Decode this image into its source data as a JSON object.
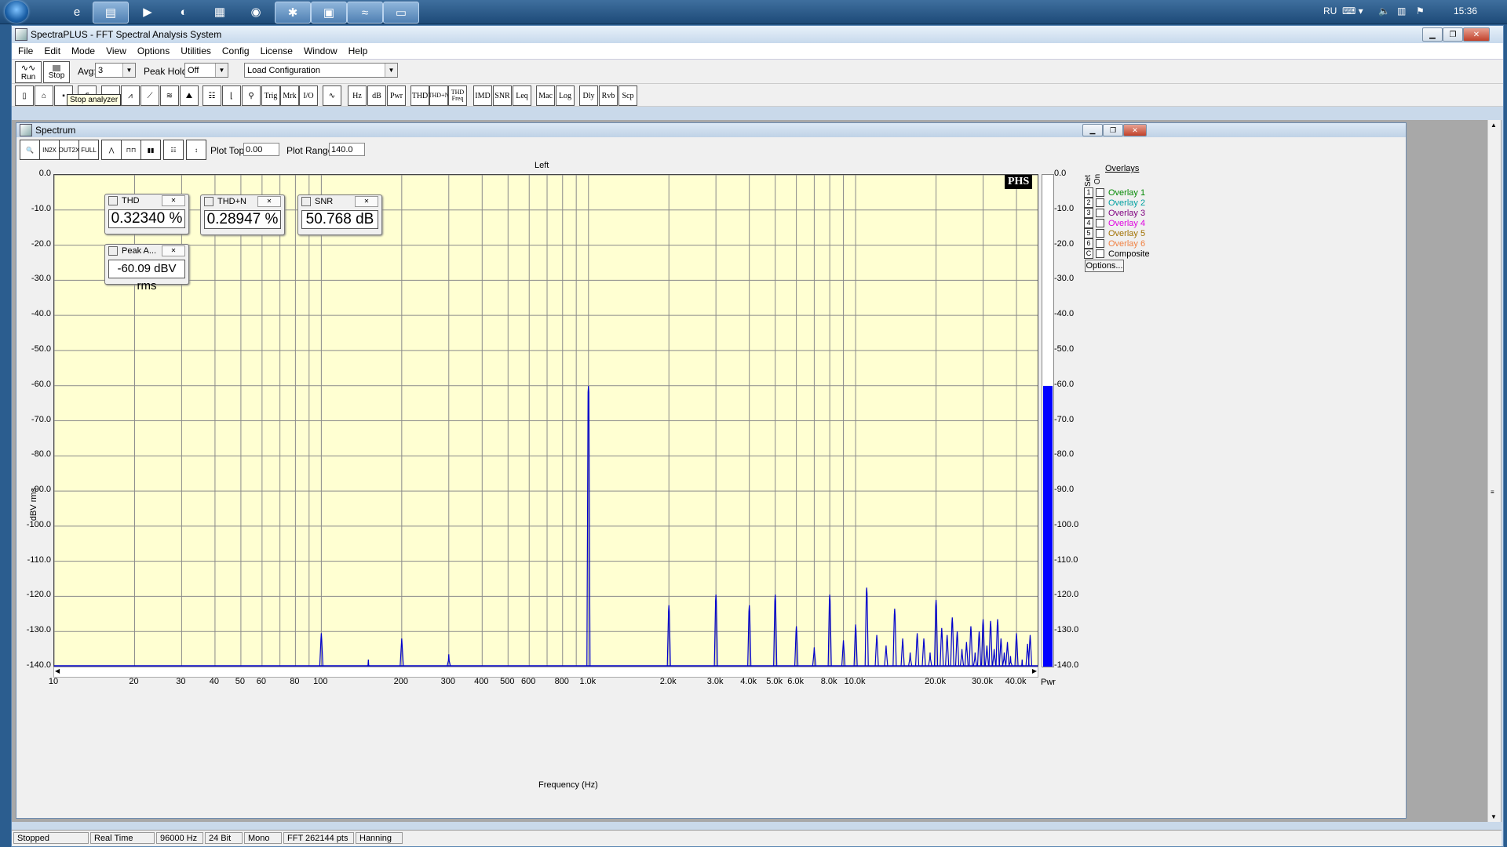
{
  "taskbar": {
    "lang": "RU",
    "clock": "15:36"
  },
  "app": {
    "title": "SpectraPLUS - FFT Spectral Analysis System"
  },
  "menu": [
    "File",
    "Edit",
    "Mode",
    "View",
    "Options",
    "Utilities",
    "Config",
    "License",
    "Window",
    "Help"
  ],
  "toolbar1": {
    "run": "Run",
    "stop": "Stop",
    "avg_label": "Avg:",
    "avg_value": "3",
    "peak_hold_label": "Peak Hold:",
    "peak_hold_value": "Off",
    "config_value": "Load Configuration",
    "tooltip": "Stop analyzer"
  },
  "toolbar2": [
    "Trig",
    "Mrk",
    "I/O",
    "Hz",
    "dB",
    "Pwr",
    "THD",
    "THD+N",
    "THD Freq",
    "IMD",
    "SNR",
    "Leq",
    "Mac",
    "Log",
    "Dly",
    "Rvb",
    "Scp"
  ],
  "spectrum": {
    "title": "Spectrum",
    "plot_top_label": "Plot Top:",
    "plot_top_value": "0.00",
    "plot_range_label": "Plot Range:",
    "plot_range_value": "140.0",
    "channel": "Left",
    "logo": "PHS",
    "meters": {
      "thd": {
        "title": "THD",
        "value": "0.32340 %"
      },
      "thdn": {
        "title": "THD+N",
        "value": "0.28947 %"
      },
      "snr": {
        "title": "SNR",
        "value": "50.768 dB"
      },
      "peak": {
        "title": "Peak A...",
        "value": "-60.09 dBV rms"
      }
    },
    "overlays": {
      "header": "Overlays",
      "set_label": "Set",
      "on_label": "On",
      "items": [
        {
          "num": "1",
          "name": "Overlay 1",
          "color": "#008800"
        },
        {
          "num": "2",
          "name": "Overlay 2",
          "color": "#00a0a0"
        },
        {
          "num": "3",
          "name": "Overlay 3",
          "color": "#800080"
        },
        {
          "num": "4",
          "name": "Overlay 4",
          "color": "#e000e0"
        },
        {
          "num": "5",
          "name": "Overlay 5",
          "color": "#a07000"
        },
        {
          "num": "6",
          "name": "Overlay 6",
          "color": "#f08040"
        },
        {
          "num": "C",
          "name": "Composite",
          "color": "#000000"
        }
      ],
      "options_button": "Options..."
    },
    "pwr_label": "Pwr"
  },
  "chart_data": {
    "type": "line",
    "title": "Left",
    "xlabel": "Frequency (Hz)",
    "ylabel": "dBV rms",
    "x_scale": "log",
    "xlim": [
      10,
      48000
    ],
    "ylim": [
      -140,
      0
    ],
    "y_ticks": [
      "0.0",
      "-10.0",
      "-20.0",
      "-30.0",
      "-40.0",
      "-50.0",
      "-60.0",
      "-70.0",
      "-80.0",
      "-90.0",
      "-100.0",
      "-110.0",
      "-120.0",
      "-130.0",
      "-140.0"
    ],
    "x_ticks": [
      {
        "v": 10,
        "t": "10"
      },
      {
        "v": 20,
        "t": "20"
      },
      {
        "v": 30,
        "t": "30"
      },
      {
        "v": 40,
        "t": "40"
      },
      {
        "v": 50,
        "t": "50"
      },
      {
        "v": 60,
        "t": "60"
      },
      {
        "v": 80,
        "t": "80"
      },
      {
        "v": 100,
        "t": "100"
      },
      {
        "v": 200,
        "t": "200"
      },
      {
        "v": 300,
        "t": "300"
      },
      {
        "v": 400,
        "t": "400"
      },
      {
        "v": 500,
        "t": "500"
      },
      {
        "v": 600,
        "t": "600"
      },
      {
        "v": 800,
        "t": "800"
      },
      {
        "v": 1000,
        "t": "1.0k"
      },
      {
        "v": 2000,
        "t": "2.0k"
      },
      {
        "v": 3000,
        "t": "3.0k"
      },
      {
        "v": 4000,
        "t": "4.0k"
      },
      {
        "v": 5000,
        "t": "5.0k"
      },
      {
        "v": 6000,
        "t": "6.0k"
      },
      {
        "v": 8000,
        "t": "8.0k"
      },
      {
        "v": 10000,
        "t": "10.0k"
      },
      {
        "v": 20000,
        "t": "20.0k"
      },
      {
        "v": 30000,
        "t": "30.0k"
      },
      {
        "v": 40000,
        "t": "40.0k"
      }
    ],
    "noise_floor": -140,
    "peaks": [
      {
        "f": 100,
        "db": -130.5
      },
      {
        "f": 150,
        "db": -138
      },
      {
        "f": 200,
        "db": -132
      },
      {
        "f": 300,
        "db": -136.5
      },
      {
        "f": 1000,
        "db": -60.1
      },
      {
        "f": 2000,
        "db": -122.5
      },
      {
        "f": 3000,
        "db": -119.5
      },
      {
        "f": 4000,
        "db": -122.5
      },
      {
        "f": 5000,
        "db": -119.5
      },
      {
        "f": 6000,
        "db": -128.5
      },
      {
        "f": 7000,
        "db": -134.5
      },
      {
        "f": 8000,
        "db": -119.5
      },
      {
        "f": 9000,
        "db": -132.5
      },
      {
        "f": 10000,
        "db": -128
      },
      {
        "f": 11000,
        "db": -117.5
      },
      {
        "f": 12000,
        "db": -131
      },
      {
        "f": 13000,
        "db": -134
      },
      {
        "f": 14000,
        "db": -123.5
      },
      {
        "f": 15000,
        "db": -132
      },
      {
        "f": 16000,
        "db": -136
      },
      {
        "f": 17000,
        "db": -130.5
      },
      {
        "f": 18000,
        "db": -132
      },
      {
        "f": 19000,
        "db": -136
      },
      {
        "f": 20000,
        "db": -121
      },
      {
        "f": 21000,
        "db": -129
      },
      {
        "f": 22000,
        "db": -131
      },
      {
        "f": 23000,
        "db": -126
      },
      {
        "f": 24000,
        "db": -130
      },
      {
        "f": 25000,
        "db": -135
      },
      {
        "f": 26000,
        "db": -133
      },
      {
        "f": 27000,
        "db": -128.5
      },
      {
        "f": 28000,
        "db": -136
      },
      {
        "f": 29000,
        "db": -130
      },
      {
        "f": 30000,
        "db": -126.5
      },
      {
        "f": 31000,
        "db": -134
      },
      {
        "f": 32000,
        "db": -127
      },
      {
        "f": 33000,
        "db": -135
      },
      {
        "f": 34000,
        "db": -126.5
      },
      {
        "f": 35000,
        "db": -132
      },
      {
        "f": 36000,
        "db": -136
      },
      {
        "f": 37000,
        "db": -133
      },
      {
        "f": 38000,
        "db": -137
      },
      {
        "f": 40000,
        "db": -130.5
      },
      {
        "f": 42000,
        "db": -138
      },
      {
        "f": 44000,
        "db": -133.5
      },
      {
        "f": 45000,
        "db": -131
      }
    ],
    "pwr_bar_db": -60.0
  },
  "status": [
    "Stopped",
    "Real Time",
    "96000 Hz",
    "24 Bit",
    "Mono",
    "FFT 262144 pts",
    "Hanning"
  ]
}
